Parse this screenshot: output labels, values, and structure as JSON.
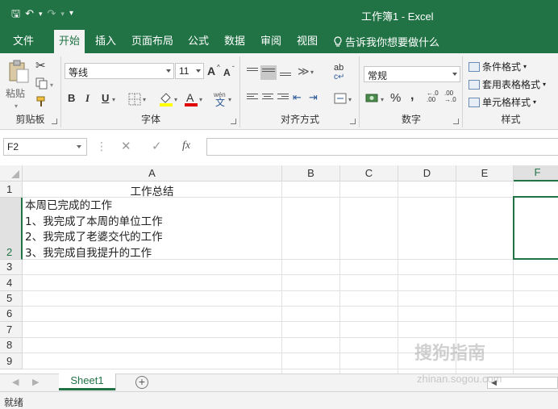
{
  "window": {
    "title": "工作簿1 - Excel"
  },
  "qat": {
    "save": "🖫",
    "undo": "↶",
    "redo": "↷",
    "more": "▾"
  },
  "tabs": [
    {
      "label": "文件"
    },
    {
      "label": "开始"
    },
    {
      "label": "插入"
    },
    {
      "label": "页面布局"
    },
    {
      "label": "公式"
    },
    {
      "label": "数据"
    },
    {
      "label": "审阅"
    },
    {
      "label": "视图"
    }
  ],
  "tellme": {
    "text": "告诉我你想要做什么"
  },
  "ribbon": {
    "clipboard": {
      "paste_label": "粘贴",
      "group_label": "剪贴板"
    },
    "font": {
      "font_name": "等线",
      "font_size": "11",
      "group_label": "字体",
      "grow": "A",
      "shrink": "A",
      "bold": "B",
      "italic": "I",
      "underline": "U",
      "phonetic": "文",
      "phonetic_top": "wén"
    },
    "align": {
      "group_label": "对齐方式",
      "wrap": "ab",
      "orient": "≫"
    },
    "number": {
      "format": "常规",
      "group_label": "数字",
      "percent": "%",
      "comma": "9",
      "inc": ".0 .00",
      "dec": ".00 .0"
    },
    "styles": {
      "conditional": "条件格式",
      "table": "套用表格格式",
      "cell": "单元格样式",
      "group_label": "样式"
    }
  },
  "formula_bar": {
    "name_box": "F2",
    "cancel": "✕",
    "enter": "✓",
    "fx": "fx",
    "value": ""
  },
  "grid": {
    "columns": [
      "A",
      "B",
      "C",
      "D",
      "E",
      "F"
    ],
    "rows": [
      "1",
      "2",
      "3",
      "4",
      "5",
      "6",
      "7",
      "8",
      "9"
    ],
    "a1": "工作总结",
    "a2_lines": [
      "本周已完成的工作",
      "1、我完成了本周的单位工作",
      "2、我完成了老婆交代的工作",
      "3、我完成自我提升的工作"
    ]
  },
  "sheets": {
    "tabs": [
      "Sheet1"
    ],
    "add": "+"
  },
  "status": {
    "text": "就绪"
  },
  "watermark": {
    "text": "搜狗指南",
    "url": "zhinan.sogou.com"
  }
}
